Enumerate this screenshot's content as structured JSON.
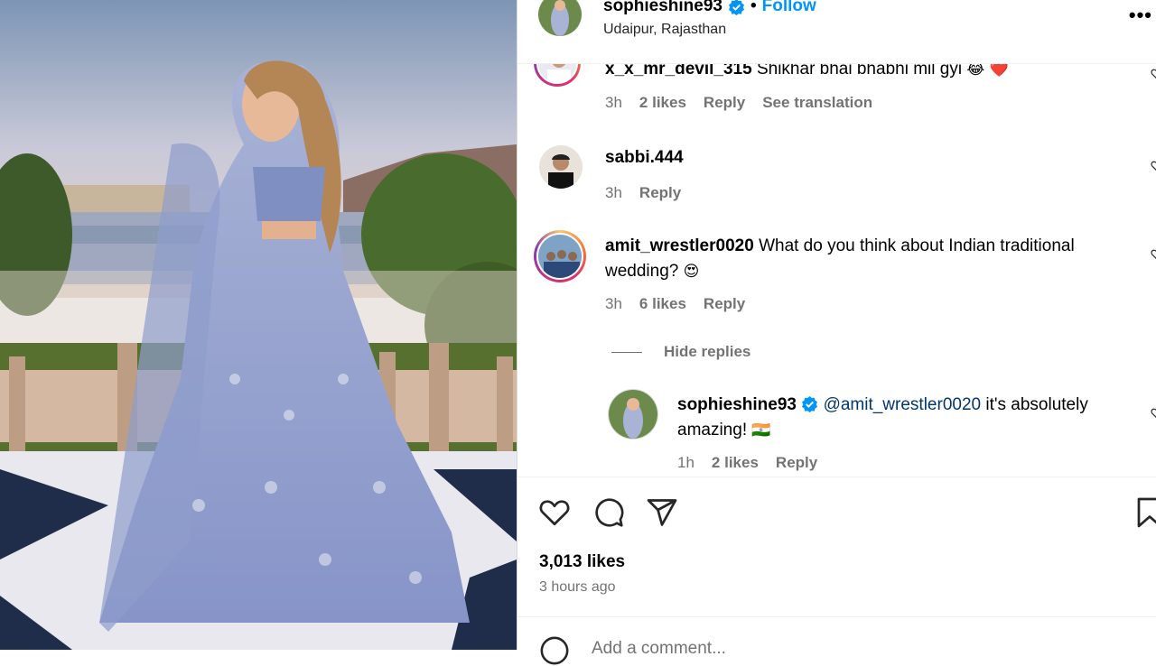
{
  "post": {
    "username": "sophieshine93",
    "follow_label": "Follow",
    "location": "Udaipur, Rajasthan",
    "likes": "3,013 likes",
    "time_ago": "3 hours ago",
    "add_comment_placeholder": "Add a comment..."
  },
  "comments": [
    {
      "username": "x_x_mr_devil_315",
      "text": "Shikhar bhai bhabhi mil gyi",
      "emoji": "😂 ❤️",
      "time": "3h",
      "likes": "2 likes",
      "reply": "Reply",
      "translation": "See translation"
    },
    {
      "username": "sabbi.444",
      "text": "",
      "time": "3h",
      "reply": "Reply"
    },
    {
      "username": "amit_wrestler0020",
      "text": "What do you think about Indian traditional wedding?",
      "emoji": "😍",
      "time": "3h",
      "likes": "6 likes",
      "reply": "Reply"
    }
  ],
  "hide_replies_label": "Hide replies",
  "reply": {
    "username": "sophieshine93",
    "mention": "@amit_wrestler0020",
    "text": "it's absolutely amazing!",
    "emoji": "🇮🇳",
    "time": "1h",
    "likes": "2 likes",
    "reply": "Reply"
  },
  "icons": [
    "verified-badge-icon",
    "more-options-icon",
    "like-heart-icon",
    "comment-bubble-icon",
    "share-send-icon",
    "save-bookmark-icon",
    "emoji-icon"
  ],
  "colors": {
    "accent": "#0095f6",
    "muted": "#737373",
    "mention": "#00376b"
  }
}
